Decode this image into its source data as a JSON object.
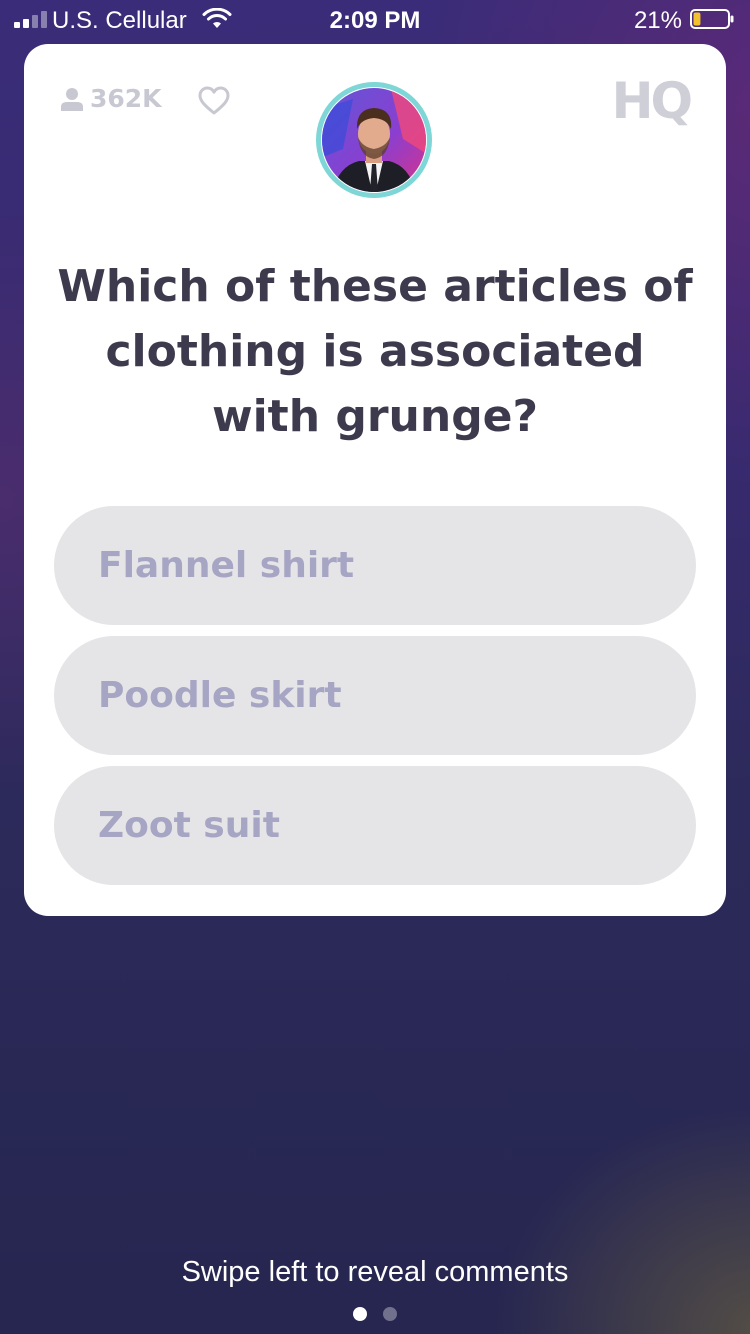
{
  "status_bar": {
    "carrier": "U.S. Cellular",
    "time": "2:09 PM",
    "battery_percent": "21%",
    "battery_level": 0.21,
    "signal_bars_filled": 2,
    "signal_bars_total": 4,
    "icons": [
      "signal-icon",
      "wifi-icon",
      "battery-icon"
    ]
  },
  "header": {
    "viewer_count": "362K",
    "icons": [
      "person-icon",
      "heart-icon"
    ],
    "logo_text": "HQ"
  },
  "question": {
    "text": "Which of these articles of clothing is associated with grunge?"
  },
  "answers": [
    {
      "label": "Flannel shirt"
    },
    {
      "label": "Poodle skirt"
    },
    {
      "label": "Zoot suit"
    }
  ],
  "footer": {
    "swipe_hint": "Swipe left to reveal comments",
    "pages_total": 2,
    "active_page": 1
  },
  "colors": {
    "accent_ring": "#7ed6d6",
    "answer_bg": "#e5e5e8",
    "answer_text": "#a7a5c4",
    "question_text": "#3c3a4c",
    "battery_fill": "#f2c12e"
  }
}
